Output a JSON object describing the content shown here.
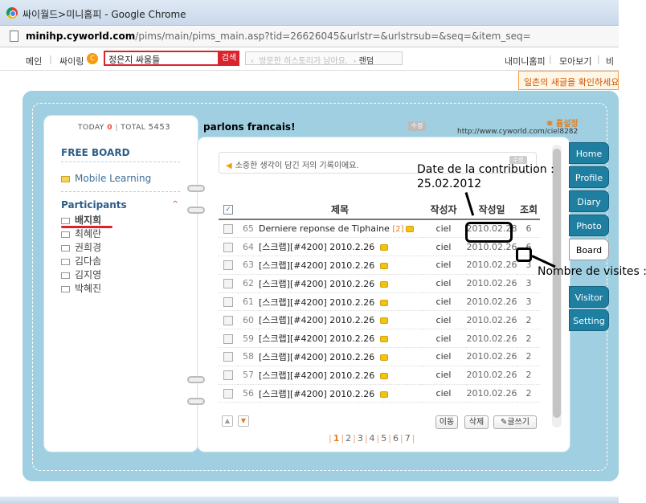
{
  "browser": {
    "window_title": "싸이월드>미니홈피 - Google Chrome",
    "url_host": "minihp.cyworld.com",
    "url_rest": "/pims/main/pims_main.asp?tid=26626045&urlstr=&urlstrsub=&seq=&item_seq="
  },
  "topnav": {
    "main": "메인",
    "cyring": "싸이링",
    "cy_badge": "C",
    "search_value": "정은지 싸움들",
    "search_button": "검색",
    "history_placeholder": "방문한 히스토리가 남아요.",
    "random": "랜덤",
    "my_minihompy": "내미니홈피",
    "collect": "모아보기",
    "more": "비",
    "tooltip": "일촌의 새글을 확인하세요"
  },
  "header": {
    "today_label": "TODAY",
    "today_value": "0",
    "total_label": "TOTAL",
    "total_value": "5453",
    "slogan": "parlons francais!",
    "edit_button": "수정",
    "home_settings": "홈설정",
    "home_url": "http://www.cyworld.com/ciel8282"
  },
  "left": {
    "free_board": "FREE BOARD",
    "mobile_learning": "Mobile Learning",
    "participants": "Participants",
    "members": [
      "배지희",
      "최혜란",
      "권희경",
      "김다솜",
      "김지영",
      "박혜진"
    ]
  },
  "board": {
    "notice": "소중한 생각이 담긴 저의 기록이에요.",
    "notice_button": "수정",
    "columns": {
      "subject": "제목",
      "author": "작성자",
      "date": "작성일",
      "views": "조회"
    },
    "rows": [
      {
        "no": "65",
        "subject": "Derniere reponse de Tiphaine",
        "count": "[2]",
        "author": "ciel",
        "date": "2010.02.28",
        "views": "6"
      },
      {
        "no": "64",
        "subject": "[스크랩][#4200] 2010.2.26",
        "count": "",
        "author": "ciel",
        "date": "2010.02.26",
        "views": "6"
      },
      {
        "no": "63",
        "subject": "[스크랩][#4200] 2010.2.26",
        "count": "",
        "author": "ciel",
        "date": "2010.02.26",
        "views": "3"
      },
      {
        "no": "62",
        "subject": "[스크랩][#4200] 2010.2.26",
        "count": "",
        "author": "ciel",
        "date": "2010.02.26",
        "views": "3"
      },
      {
        "no": "61",
        "subject": "[스크랩][#4200] 2010.2.26",
        "count": "",
        "author": "ciel",
        "date": "2010.02.26",
        "views": "3"
      },
      {
        "no": "60",
        "subject": "[스크랩][#4200] 2010.2.26",
        "count": "",
        "author": "ciel",
        "date": "2010.02.26",
        "views": "2"
      },
      {
        "no": "59",
        "subject": "[스크랩][#4200] 2010.2.26",
        "count": "",
        "author": "ciel",
        "date": "2010.02.26",
        "views": "2"
      },
      {
        "no": "58",
        "subject": "[스크랩][#4200] 2010.2.26",
        "count": "",
        "author": "ciel",
        "date": "2010.02.26",
        "views": "2"
      },
      {
        "no": "57",
        "subject": "[스크랩][#4200] 2010.2.26",
        "count": "",
        "author": "ciel",
        "date": "2010.02.26",
        "views": "2"
      },
      {
        "no": "56",
        "subject": "[스크랩][#4200] 2010.2.26",
        "count": "",
        "author": "ciel",
        "date": "2010.02.26",
        "views": "2"
      }
    ],
    "move_button": "이동",
    "delete_button": "삭제",
    "write_button": "글쓰기",
    "pages": [
      "1",
      "2",
      "3",
      "4",
      "5",
      "6",
      "7"
    ],
    "current_page": "1"
  },
  "tabs": [
    "Home",
    "Profile",
    "Diary",
    "Photo",
    "Board",
    "Visitor",
    "Setting"
  ],
  "active_tab": "Board",
  "annotations": {
    "date_line1": "Date de la contribution :",
    "date_line2": "25.02.2012",
    "visits": "Nombre de visites : 6"
  },
  "colors": {
    "frame": "#9fcfe0",
    "tab": "#1f7fa1",
    "search_red": "#d9232d",
    "accent_orange": "#e67e22"
  }
}
